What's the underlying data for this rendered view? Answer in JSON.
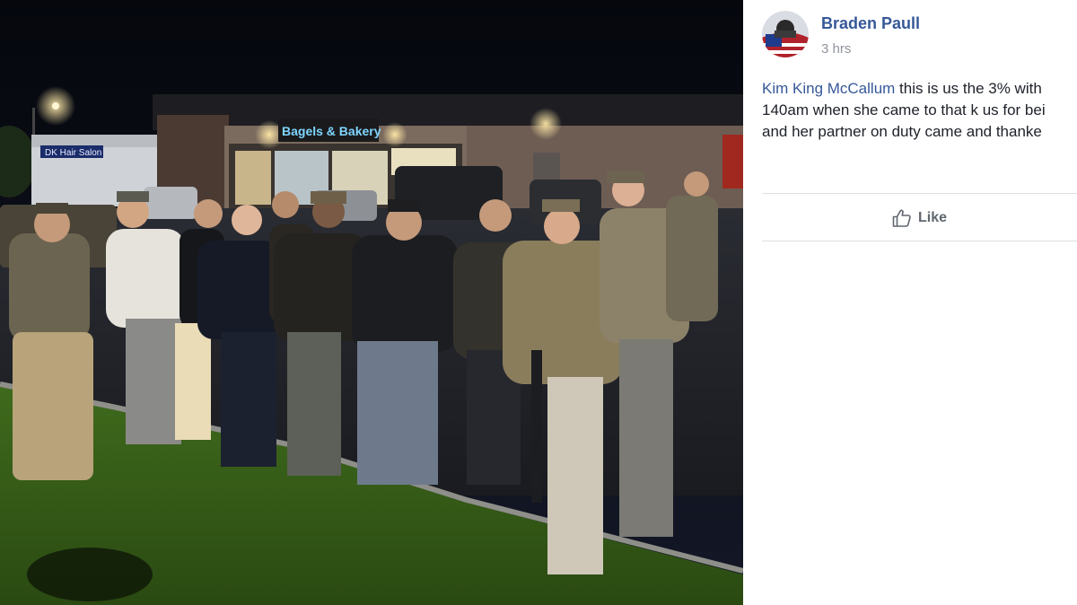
{
  "post": {
    "author": "Braden Paull",
    "timestamp": "3 hrs",
    "mention": "Kim King McCallum",
    "line1_rest": " this is us the 3% with",
    "line2": "140am when she came to that k us for bei",
    "line3": "and her partner on duty came and thanke"
  },
  "actions": {
    "like_label": "Like"
  },
  "photo": {
    "storefront_sign": "Bagels & Bakery",
    "side_sign": "DK Hair Salon"
  },
  "icons": {
    "like": "thumbs-up-outline-icon",
    "avatar": "profile-avatar-icon"
  },
  "colors": {
    "link": "#365899",
    "text": "#1d2129",
    "meta": "#90949c",
    "divider": "#dddfe2",
    "action": "#606770"
  }
}
